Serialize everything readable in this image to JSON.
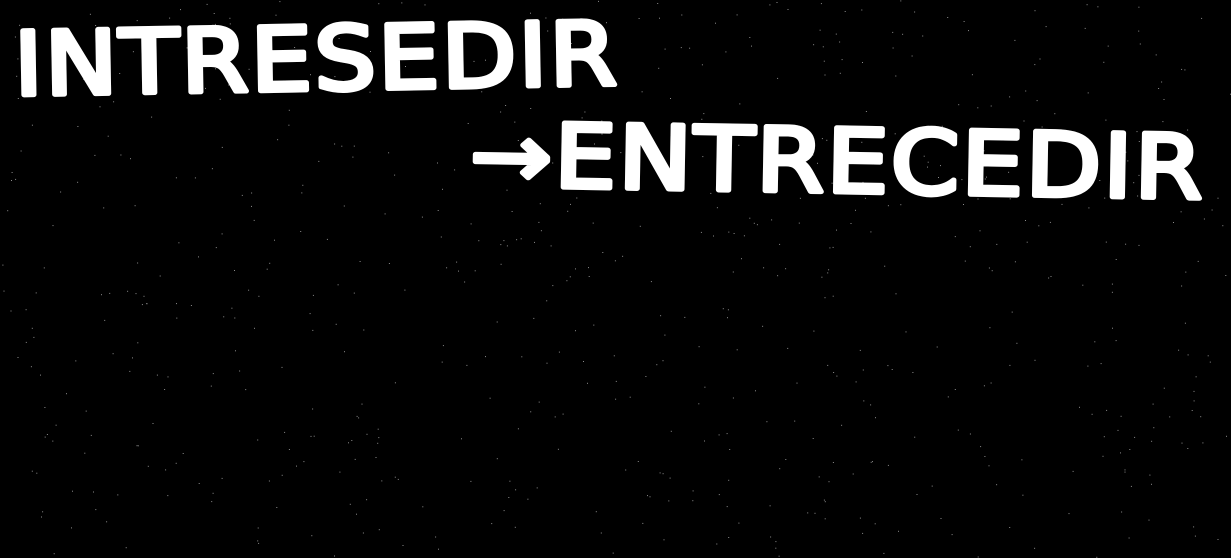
{
  "handwriting": {
    "line1": "INTRESEDIR",
    "line2": "→ENTRECEDIR"
  },
  "colors": {
    "background": "#000000",
    "ink": "#ffffff"
  }
}
